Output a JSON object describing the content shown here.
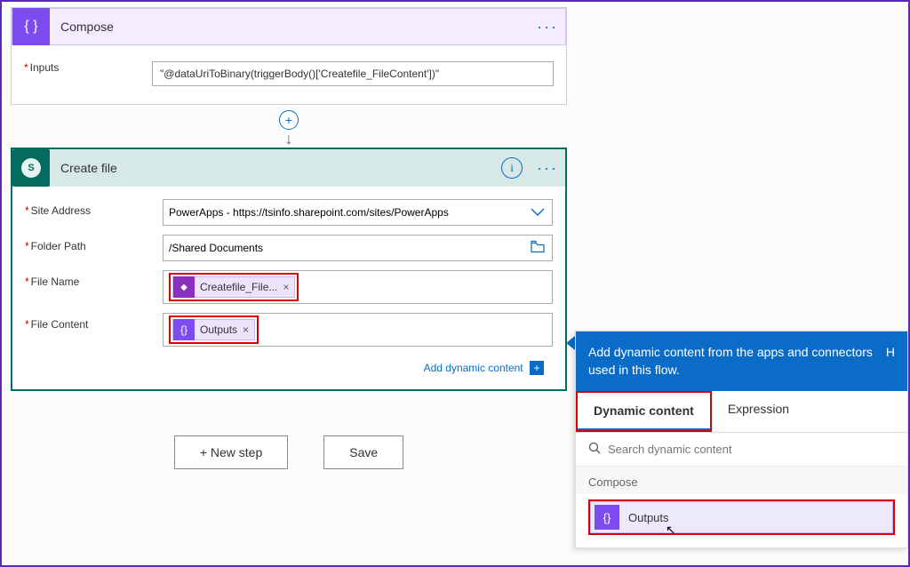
{
  "compose": {
    "title": "Compose",
    "inputs_label": "Inputs",
    "inputs_value": "\"@dataUriToBinary(triggerBody()['Createfile_FileContent'])\""
  },
  "create_file": {
    "title": "Create file",
    "fields": {
      "site_address": {
        "label": "Site Address",
        "value": "PowerApps - https://tsinfo.sharepoint.com/sites/PowerApps"
      },
      "folder_path": {
        "label": "Folder Path",
        "value": "/Shared Documents"
      },
      "file_name": {
        "label": "File Name",
        "token": "Createfile_File..."
      },
      "file_content": {
        "label": "File Content",
        "token": "Outputs"
      }
    },
    "add_dynamic": "Add dynamic content"
  },
  "buttons": {
    "new_step": "+ New step",
    "save": "Save"
  },
  "dynamic_panel": {
    "header": "Add dynamic content from the apps and connectors used in this flow.",
    "header_h": "H",
    "tabs": {
      "dynamic": "Dynamic content",
      "expression": "Expression"
    },
    "search_placeholder": "Search dynamic content",
    "group_label": "Compose",
    "item_label": "Outputs"
  }
}
